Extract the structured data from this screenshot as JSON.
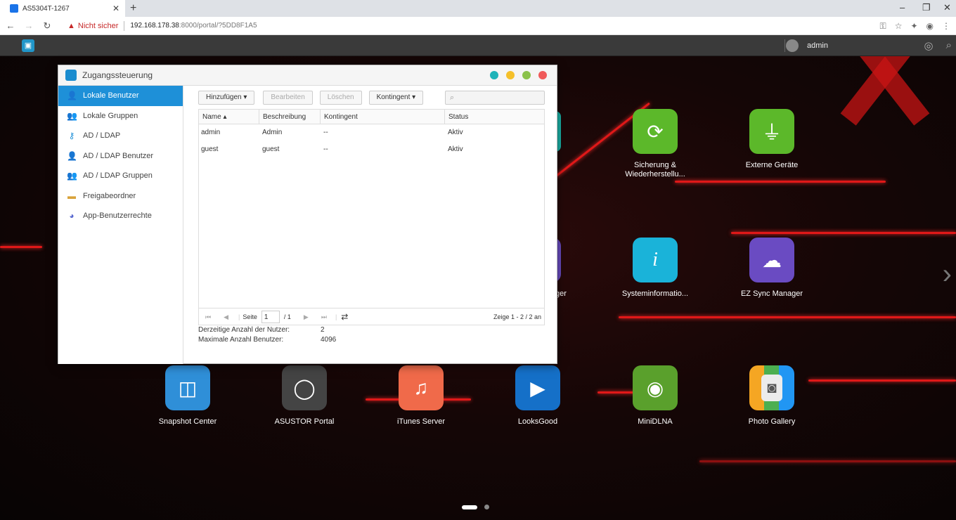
{
  "browser": {
    "tab_title": "AS5304T-1267",
    "security_label": "Nicht sicher",
    "url_host": "192.168.178.38",
    "url_rest": ":8000/portal/?5DD8F1A5"
  },
  "taskbar": {
    "user_name": "admin"
  },
  "window": {
    "title": "Zugangssteuerung"
  },
  "sidebar": {
    "items": [
      {
        "label": "Lokale Benutzer",
        "icon": "user-icon"
      },
      {
        "label": "Lokale Gruppen",
        "icon": "group-icon"
      },
      {
        "label": "AD / LDAP",
        "icon": "key-icon"
      },
      {
        "label": "AD / LDAP Benutzer",
        "icon": "user-icon"
      },
      {
        "label": "AD / LDAP Gruppen",
        "icon": "group-icon"
      },
      {
        "label": "Freigabeordner",
        "icon": "folder-icon"
      },
      {
        "label": "App-Benutzerrechte",
        "icon": "app-rights-icon"
      }
    ]
  },
  "toolbar": {
    "add": "Hinzufügen ▾",
    "edit": "Bearbeiten",
    "delete": "Löschen",
    "quota": "Kontingent ▾"
  },
  "grid": {
    "columns": [
      "Name ▴",
      "Beschreibung",
      "Kontingent",
      "Status"
    ],
    "rows": [
      [
        "admin",
        "Admin",
        "--",
        "Aktiv"
      ],
      [
        "guest",
        "guest",
        "--",
        "Aktiv"
      ]
    ]
  },
  "pager": {
    "page_label": "Seite",
    "page_value": "1",
    "page_total": "/ 1",
    "info": "Zeige 1 - 2 / 2 an"
  },
  "footer": {
    "current_label": "Derzeitige Anzahl der Nutzer:",
    "current_value": "2",
    "max_label": "Maximale Anzahl Benutzer:",
    "max_value": "4096"
  },
  "desktop_apps": [
    {
      "label": "Sicherung & Wiederherstellu...",
      "color": "#5cb82a",
      "icon": "backup-icon"
    },
    {
      "label": "Externe Geräte",
      "color": "#5cb82a",
      "icon": "usb-icon"
    },
    {
      "label": "Systeminformatio...",
      "color": "#1ab3d9",
      "icon": "info-icon"
    },
    {
      "label": "EZ Sync Manager",
      "color": "#6a4bc2",
      "icon": "cloud-sync-icon"
    },
    {
      "label": "Snapshot Center",
      "color": "#2f8fd8",
      "icon": "database-icon"
    },
    {
      "label": "ASUSTOR Portal",
      "color": "#444444",
      "icon": "portal-icon"
    },
    {
      "label": "iTunes Server",
      "color": "#f06a4a",
      "icon": "music-note-icon"
    },
    {
      "label": "LooksGood",
      "color": "#1570c8",
      "icon": "play-icon"
    },
    {
      "label": "MiniDLNA",
      "color": "#5aa02c",
      "icon": "dlna-icon"
    },
    {
      "label": "Photo Gallery",
      "color": "#f0f0f0",
      "icon": "camera-icon"
    },
    {
      "label": "ger",
      "color": "#6a4bc2",
      "icon": "partial-app-icon"
    }
  ],
  "colors": {
    "accent": "#1e90d8",
    "dot_teal": "#1fb3b8",
    "dot_yellow": "#f5c02a",
    "dot_green": "#8bc24a",
    "dot_red": "#f05a5a"
  }
}
